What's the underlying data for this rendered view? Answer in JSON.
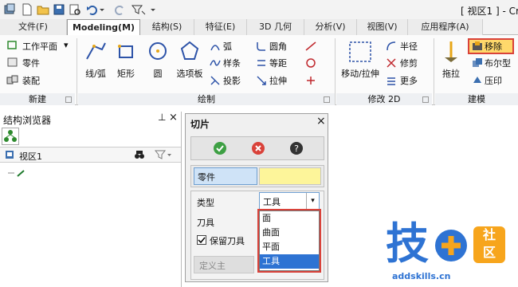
{
  "quick_access": {
    "icons": [
      "new-file-icon",
      "open-folder-icon",
      "save-icon",
      "print-preview-icon",
      "undo-icon",
      "redo-icon",
      "filter-toggle-icon"
    ]
  },
  "window_title": "[ 视区1 ] - Cr",
  "tabs": [
    {
      "label": "文件(F)",
      "active": false
    },
    {
      "label": "Modeling(M)",
      "active": true
    },
    {
      "label": "结构(S)",
      "active": false
    },
    {
      "label": "特征(E)",
      "active": false
    },
    {
      "label": "3D 几何",
      "active": false
    },
    {
      "label": "分析(V)",
      "active": false
    },
    {
      "label": "视图(V)",
      "active": false
    },
    {
      "label": "应用程序(A)",
      "active": false
    }
  ],
  "ribbon": {
    "new_group": {
      "label": "新建",
      "items": [
        "工作平面",
        "零件",
        "装配"
      ]
    },
    "draw_group": {
      "label": "绘制",
      "big_buttons": [
        "线/弧",
        "矩形",
        "圆",
        "选项板"
      ],
      "small_col1": [
        "弧",
        "样条",
        "投影"
      ],
      "small_col2": [
        "圆角",
        "等距",
        "拉伸"
      ]
    },
    "modify_group": {
      "label": "修改 2D",
      "big_button": "移动/拉伸",
      "items": [
        "半径",
        "修剪",
        "更多"
      ]
    },
    "model_group": {
      "label": "建模",
      "big_button": "拖拉",
      "items": [
        "移除",
        "布尔型",
        "压印"
      ]
    }
  },
  "left_panel": {
    "title": "结构浏览器",
    "pin": "ᵖ",
    "close": "×",
    "view_name": "视区1"
  },
  "dialog": {
    "title": "切片",
    "close": "×",
    "part_label": "零件",
    "part_value": "",
    "type_label": "类型",
    "type_value": "工具",
    "tool_label": "刀具",
    "keep_tool_label": "保留刀具",
    "keep_tool_checked": true,
    "define_label": "定义主",
    "type_options": [
      "面",
      "曲面",
      "平面",
      "工具"
    ],
    "selected_option": "工具"
  },
  "watermark": {
    "text": "技",
    "site": "addskills.cn",
    "badge_line1": "社",
    "badge_line2": "区"
  }
}
